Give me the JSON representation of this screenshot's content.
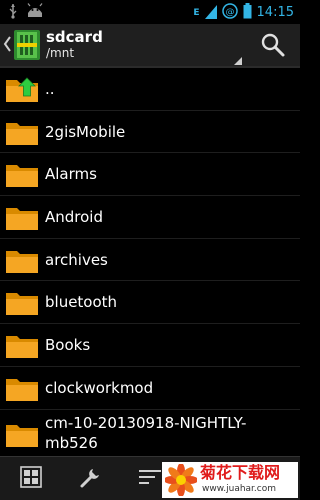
{
  "status_bar": {
    "time": "14:15",
    "network_label": "E"
  },
  "action_bar": {
    "title": "sdcard",
    "subtitle": "/mnt"
  },
  "files": [
    {
      "name": ".."
    },
    {
      "name": "2gisMobile"
    },
    {
      "name": "Alarms"
    },
    {
      "name": "Android"
    },
    {
      "name": "archives"
    },
    {
      "name": "bluetooth"
    },
    {
      "name": "Books"
    },
    {
      "name": "clockworkmod"
    },
    {
      "name": "cm-10-20130918-NIGHTLY-mb526"
    }
  ],
  "watermark": {
    "title": "菊花下载网",
    "url": "www.juahar.com"
  },
  "colors": {
    "accent": "#33b5e5",
    "folder": "#f5a623",
    "up_arrow": "#2ecc40"
  },
  "icons": {
    "status_left": [
      "usb-icon",
      "android-debug-icon"
    ],
    "status_right": [
      "wifi-icon",
      "signal-icon",
      "battery-icon"
    ],
    "action_bar": [
      "back-chevron-icon",
      "app-icon",
      "spinner-icon",
      "search-icon"
    ],
    "bottom_bar": [
      "grid-view-icon",
      "tools-icon",
      "sort-icon"
    ]
  }
}
